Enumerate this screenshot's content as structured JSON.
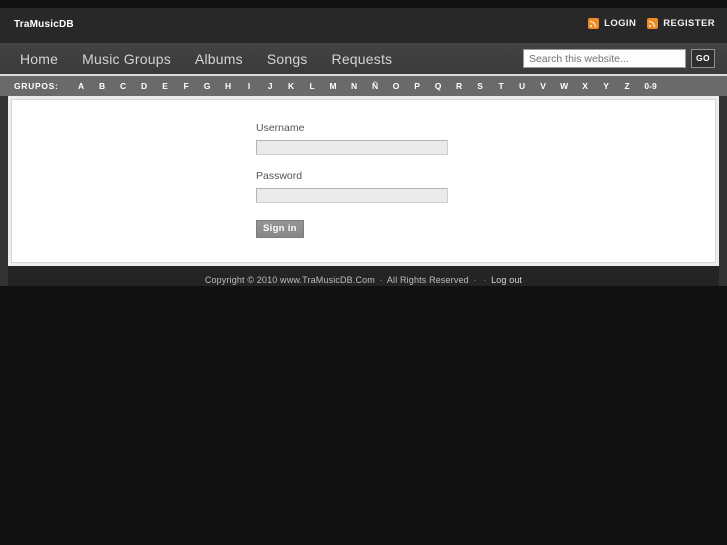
{
  "header": {
    "site_title": "TraMusicDB",
    "links": [
      {
        "label": "LOGIN",
        "icon": "rss-icon"
      },
      {
        "label": "REGISTER",
        "icon": "rss-icon"
      }
    ]
  },
  "nav": {
    "items": [
      {
        "label": "Home"
      },
      {
        "label": "Music Groups"
      },
      {
        "label": "Albums"
      },
      {
        "label": "Songs"
      },
      {
        "label": "Requests"
      }
    ],
    "search": {
      "placeholder": "Search this website...",
      "value": "",
      "button_label": "GO"
    }
  },
  "alphabar": {
    "label": "GRUPOS:",
    "letters": [
      "A",
      "B",
      "C",
      "D",
      "E",
      "F",
      "G",
      "H",
      "I",
      "J",
      "K",
      "L",
      "M",
      "N",
      "Ñ",
      "O",
      "P",
      "Q",
      "R",
      "S",
      "T",
      "U",
      "V",
      "W",
      "X",
      "Y",
      "Z",
      "0-9"
    ]
  },
  "login_form": {
    "username_label": "Username",
    "username_value": "",
    "password_label": "Password",
    "password_value": "",
    "submit_label": "Sign in"
  },
  "footer": {
    "copyright": "Copyright © 2010 www.TraMusicDB.Com",
    "sep1": "·",
    "rights": "All Rights Reserved",
    "sep2": "·",
    "sep3": "·",
    "logout_label": "Log out"
  },
  "colors": {
    "accent_orange": "#f08a24",
    "header_bg": "#282828",
    "nav_bg": "#3c3c3c",
    "alphabar_bg": "#6a6a6a",
    "footer_bg": "#242424",
    "page_bg": "#111111"
  }
}
